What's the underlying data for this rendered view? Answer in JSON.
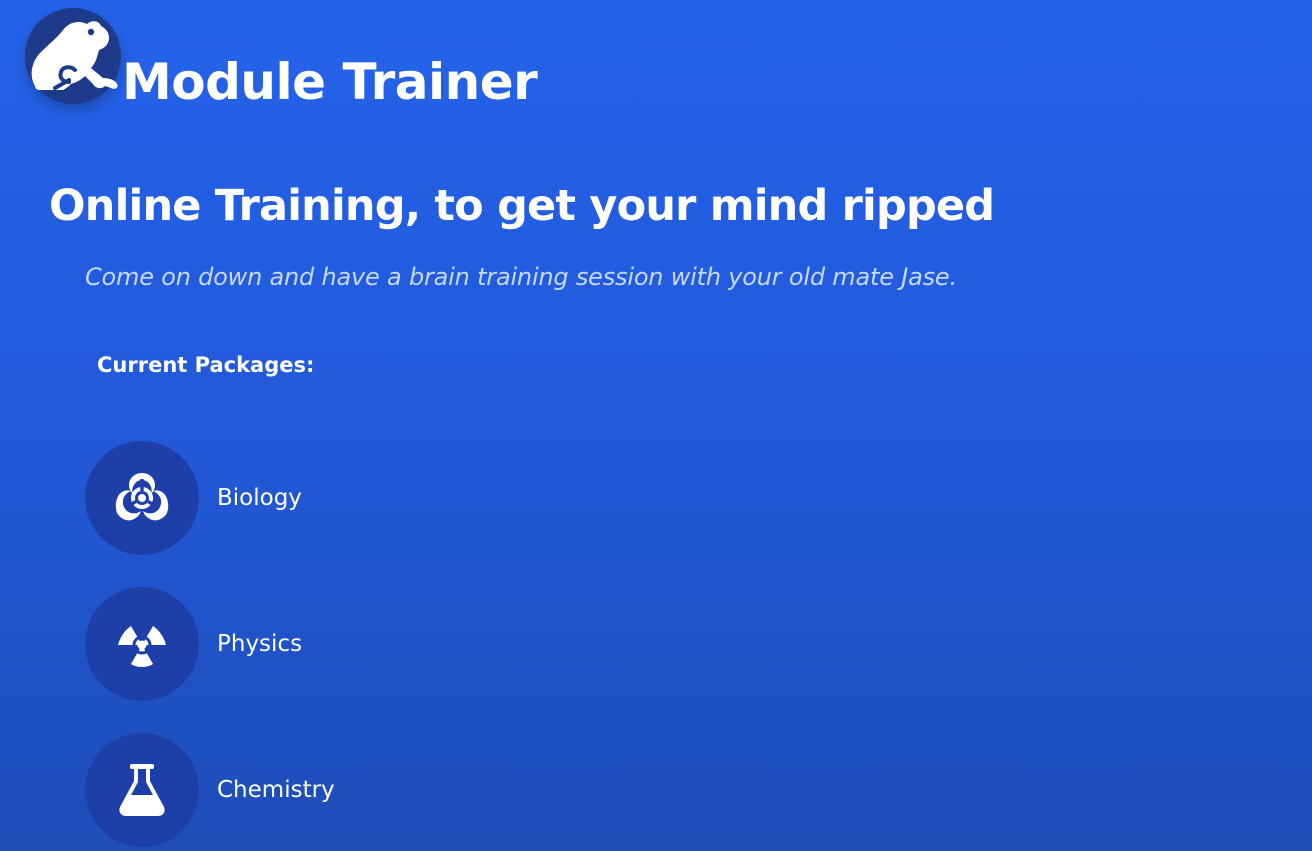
{
  "header": {
    "logo_icon": "frog-icon",
    "title": "Module Trainer"
  },
  "hero": {
    "headline": "Online Training, to get your mind ripped",
    "tagline": "Come on down and have a brain training session with your old mate Jase."
  },
  "packages": {
    "heading": "Current Packages:",
    "items": [
      {
        "label": "Biology",
        "icon": "biohazard-icon"
      },
      {
        "label": "Physics",
        "icon": "radiation-icon"
      },
      {
        "label": "Chemistry",
        "icon": "flask-icon"
      }
    ]
  },
  "colors": {
    "background": "#2563eb",
    "logo_circle": "#1e3a8a",
    "icon_circle": "#1e3fa8",
    "text": "#ffffff",
    "tagline": "#c7d8fb"
  }
}
